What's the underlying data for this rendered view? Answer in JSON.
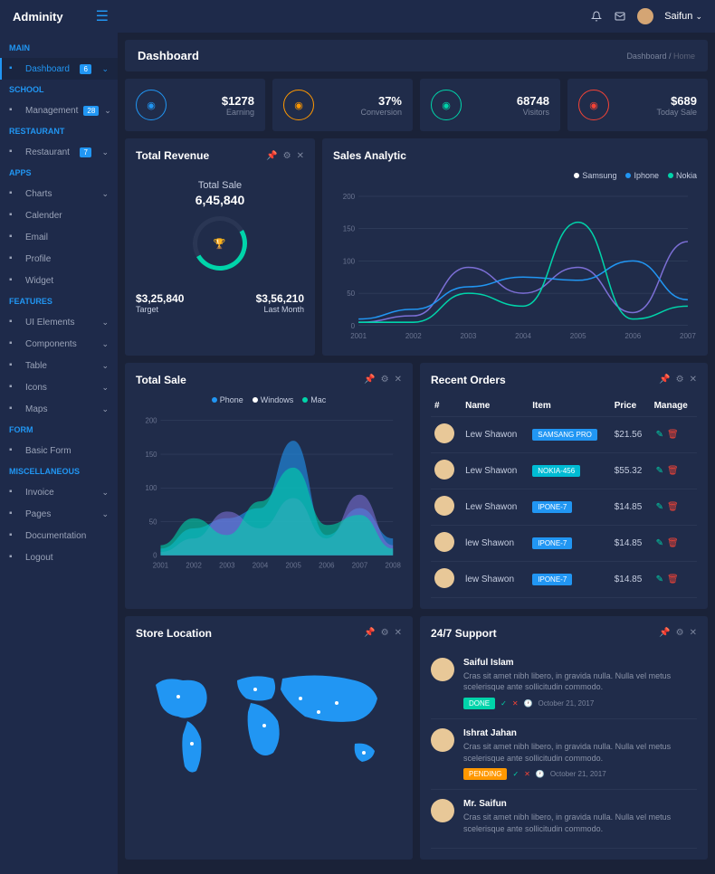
{
  "brand": "Adminity",
  "user": "Saifun",
  "page_title": "Dashboard",
  "breadcrumb": {
    "root": "Dashboard",
    "current": "Home"
  },
  "sidebar": {
    "sections": [
      {
        "head": "MAIN",
        "items": [
          {
            "label": "Dashboard",
            "badge": "6",
            "active": true
          }
        ]
      },
      {
        "head": "SCHOOL",
        "items": [
          {
            "label": "Management",
            "badge": "28"
          }
        ]
      },
      {
        "head": "RESTAURANT",
        "items": [
          {
            "label": "Restaurant",
            "badge": "7"
          }
        ]
      },
      {
        "head": "APPS",
        "items": [
          {
            "label": "Charts",
            "chev": true
          },
          {
            "label": "Calender"
          },
          {
            "label": "Email"
          },
          {
            "label": "Profile"
          },
          {
            "label": "Widget"
          }
        ]
      },
      {
        "head": "FEATURES",
        "items": [
          {
            "label": "UI Elements",
            "chev": true
          },
          {
            "label": "Components",
            "chev": true
          },
          {
            "label": "Table",
            "chev": true
          },
          {
            "label": "Icons",
            "chev": true
          },
          {
            "label": "Maps",
            "chev": true
          }
        ]
      },
      {
        "head": "FORM",
        "items": [
          {
            "label": "Basic Form"
          }
        ]
      },
      {
        "head": "MISCELLANEOUS",
        "items": [
          {
            "label": "Invoice",
            "chev": true
          },
          {
            "label": "Pages",
            "chev": true
          },
          {
            "label": "Documentation"
          },
          {
            "label": "Logout"
          }
        ]
      }
    ]
  },
  "stats": [
    {
      "value": "$1278",
      "label": "Earning",
      "color": "c-blue"
    },
    {
      "value": "37%",
      "label": "Conversion",
      "color": "c-org"
    },
    {
      "value": "68748",
      "label": "Visitors",
      "color": "c-grn"
    },
    {
      "value": "$689",
      "label": "Today Sale",
      "color": "c-red"
    }
  ],
  "revenue": {
    "title": "Total Revenue",
    "donut_label": "Total Sale",
    "donut_value": "6,45,840",
    "target_val": "$3,25,840",
    "target_lbl": "Target",
    "lm_val": "$3,56,210",
    "lm_lbl": "Last Month"
  },
  "sales_analytic": {
    "title": "Sales Analytic",
    "legend": [
      "Samsung",
      "Iphone",
      "Nokia"
    ]
  },
  "total_sale": {
    "title": "Total Sale",
    "legend": [
      "Phone",
      "Windows",
      "Mac"
    ]
  },
  "orders": {
    "title": "Recent Orders",
    "cols": [
      "#",
      "Name",
      "Item",
      "Price",
      "Manage"
    ],
    "rows": [
      {
        "name": "Lew Shawon",
        "item": "SAMSANG PRO",
        "tag": "t-blu",
        "price": "$21.56"
      },
      {
        "name": "Lew Shawon",
        "item": "NOKIA-456",
        "tag": "t-cyn",
        "price": "$55.32"
      },
      {
        "name": "Lew Shawon",
        "item": "IPONE-7",
        "tag": "t-blu",
        "price": "$14.85"
      },
      {
        "name": "lew Shawon",
        "item": "IPONE-7",
        "tag": "t-blu",
        "price": "$14.85"
      },
      {
        "name": "lew Shawon",
        "item": "IPONE-7",
        "tag": "t-blu",
        "price": "$14.85"
      }
    ]
  },
  "store": {
    "title": "Store Location"
  },
  "support": {
    "title": "24/7 Support",
    "items": [
      {
        "name": "Saiful Islam",
        "text": "Cras sit amet nibh libero, in gravida nulla. Nulla vel metus scelerisque ante sollicitudin commodo.",
        "status": "DONE",
        "status_cls": "t-grn",
        "time": "October 21, 2017"
      },
      {
        "name": "Ishrat Jahan",
        "text": "Cras sit amet nibh libero, in gravida nulla. Nulla vel metus scelerisque ante sollicitudin commodo.",
        "status": "PENDING",
        "status_cls": "t-org",
        "time": "October 21, 2017"
      },
      {
        "name": "Mr. Saifun",
        "text": "Cras sit amet nibh libero, in gravida nulla. Nulla vel metus scelerisque ante sollicitudin commodo.",
        "status": "",
        "status_cls": "",
        "time": ""
      }
    ]
  },
  "chart_data": [
    {
      "id": "sales_analytic",
      "type": "line",
      "categories": [
        "2001",
        "2002",
        "2003",
        "2004",
        "2005",
        "2006",
        "2007"
      ],
      "ylim": [
        0,
        200
      ],
      "series": [
        {
          "name": "Samsung",
          "color": "#7c6fd6",
          "values": [
            5,
            15,
            90,
            50,
            90,
            20,
            130
          ]
        },
        {
          "name": "Iphone",
          "color": "#2196f3",
          "values": [
            10,
            25,
            60,
            75,
            70,
            100,
            40
          ]
        },
        {
          "name": "Nokia",
          "color": "#00d4aa",
          "values": [
            5,
            5,
            50,
            30,
            160,
            10,
            30
          ]
        }
      ]
    },
    {
      "id": "total_sale",
      "type": "area",
      "categories": [
        "2001",
        "2002",
        "2003",
        "2004",
        "2005",
        "2006",
        "2007",
        "2008"
      ],
      "ylim": [
        0,
        200
      ],
      "series": [
        {
          "name": "Phone",
          "color": "#2196f3",
          "values": [
            10,
            40,
            55,
            70,
            170,
            30,
            70,
            25
          ]
        },
        {
          "name": "Windows",
          "color": "#7c6fd6",
          "values": [
            5,
            25,
            65,
            40,
            85,
            25,
            90,
            15
          ]
        },
        {
          "name": "Mac",
          "color": "#00d4aa",
          "values": [
            15,
            55,
            30,
            80,
            130,
            45,
            60,
            10
          ]
        }
      ]
    }
  ]
}
